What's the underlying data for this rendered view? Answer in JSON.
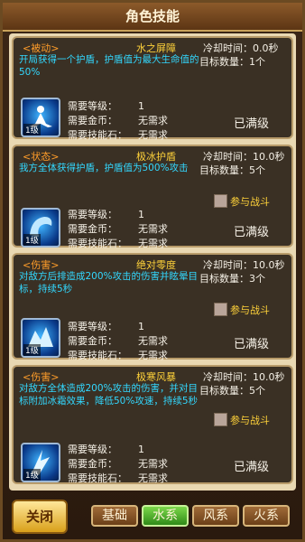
{
  "window": {
    "title": "角色技能"
  },
  "labels": {
    "req_level": "需要等级：",
    "req_gold": "需要金币：",
    "req_stone": "需要技能石：",
    "join_battle": "参与战斗"
  },
  "skills": [
    {
      "tag": "<被动>",
      "name": "水之屏障",
      "cooldown": "冷却时间：0.0秒",
      "targets": "目标数量：1个",
      "desc": "开局获得一个护盾，护盾值为最大生命值的50%",
      "level": "1级",
      "req_level": "1",
      "req_gold": "无需求",
      "req_stone": "无需求",
      "status": "已满级"
    },
    {
      "tag": "<状态>",
      "name": "极冰护盾",
      "cooldown": "冷却时间：10.0秒",
      "targets": "目标数量：5个",
      "desc": "我方全体获得护盾，护盾值为500%攻击",
      "level": "1级",
      "req_level": "1",
      "req_gold": "无需求",
      "req_stone": "无需求",
      "status": "已满级"
    },
    {
      "tag": "<伤害>",
      "name": "绝对零度",
      "cooldown": "冷却时间：10.0秒",
      "targets": "目标数量：3个",
      "desc": "对敌方后排造成200%攻击的伤害并眩晕目标，持续5秒",
      "level": "1级",
      "req_level": "1",
      "req_gold": "无需求",
      "req_stone": "无需求",
      "status": "已满级"
    },
    {
      "tag": "<伤害>",
      "name": "极寒风暴",
      "cooldown": "冷却时间：10.0秒",
      "targets": "目标数量：5个",
      "desc": "对敌方全体造成200%攻击的伤害，并对目标附加冰霜效果，降低50%攻速，持续5秒",
      "level": "1级",
      "req_level": "1",
      "req_gold": "无需求",
      "req_stone": "无需求",
      "status": "已满级"
    }
  ],
  "footer": {
    "close_label": "关闭",
    "tabs": [
      "基础",
      "水系",
      "风系",
      "火系"
    ],
    "active_tab": "水系"
  },
  "icons": [
    "meditation-icon",
    "ice-shield-icon",
    "ice-crystal-icon",
    "ice-storm-icon"
  ]
}
